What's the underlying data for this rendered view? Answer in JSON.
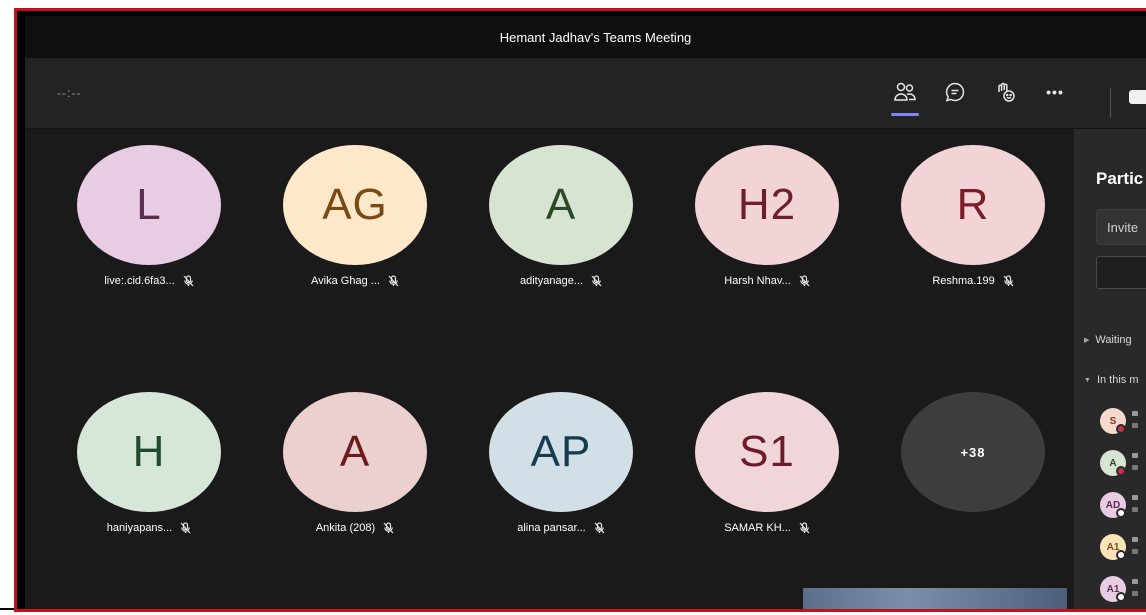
{
  "window": {
    "title": "Hemant Jadhav's Teams Meeting"
  },
  "toolbar": {
    "timer": "--:--",
    "buttons": [
      {
        "id": "people",
        "icon": "people-icon",
        "active": true
      },
      {
        "id": "chat",
        "icon": "chat-icon"
      },
      {
        "id": "reactions",
        "icon": "raise-hand-icon"
      },
      {
        "id": "more",
        "icon": "more-icon",
        "label": "•••"
      }
    ]
  },
  "gallery": {
    "tiles": [
      {
        "initials": "L",
        "name": "live:.cid.6fa3...",
        "bg": "#e8cce4",
        "fg": "#5b2d52"
      },
      {
        "initials": "AG",
        "name": "Avika Ghag ...",
        "bg": "#fde8c9",
        "fg": "#7a4a15"
      },
      {
        "initials": "A",
        "name": "adityanage...",
        "bg": "#d8e4d2",
        "fg": "#2a4a26"
      },
      {
        "initials": "H2",
        "name": "Harsh Nhav...",
        "bg": "#f2d4d6",
        "fg": "#6e1f2d"
      },
      {
        "initials": "R",
        "name": "Reshma.199",
        "bg": "#f2d4d6",
        "fg": "#7a1c2a"
      },
      {
        "initials": "H",
        "name": "haniyapans...",
        "bg": "#d6e6d8",
        "fg": "#1f4a2c"
      },
      {
        "initials": "A",
        "name": "Ankita (208)",
        "bg": "#ebd0cf",
        "fg": "#6e1a1a"
      },
      {
        "initials": "AP",
        "name": "alina pansar...",
        "bg": "#d2dfe7",
        "fg": "#163c52"
      },
      {
        "initials": "S1",
        "name": "SAMAR KH...",
        "bg": "#f0d6d9",
        "fg": "#6e1a2c"
      }
    ],
    "overflow": "+38"
  },
  "panel": {
    "title": "Partic",
    "invite_label": "Invite",
    "waiting_label": "Waiting",
    "in_meeting_label": "In this m",
    "participants": [
      {
        "initials": "S",
        "bg": "#f5d9cc",
        "fg": "#7a3a1d",
        "status": "#c4314b"
      },
      {
        "initials": "A",
        "bg": "#d8e4d2",
        "fg": "#2a4a26",
        "status": "#c4314b"
      },
      {
        "initials": "AD",
        "bg": "#e8cce4",
        "fg": "#5b2d52",
        "status": "#ffffff"
      },
      {
        "initials": "A1",
        "bg": "#fbe3b8",
        "fg": "#7a4a15",
        "status": "#ffffff"
      },
      {
        "initials": "A1",
        "bg": "#e8cce4",
        "fg": "#5b2d52",
        "status": "#ffffff"
      }
    ]
  }
}
